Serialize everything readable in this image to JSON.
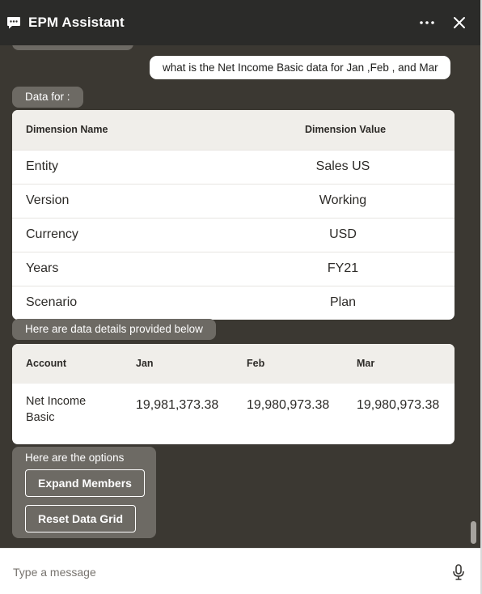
{
  "header": {
    "title": "EPM Assistant",
    "icons": {
      "chat": "chat-bubble-icon",
      "more": "more-horizontal-icon",
      "close": "close-icon"
    }
  },
  "conversation": {
    "user_message": "what is the Net Income Basic data for Jan ,Feb , and Mar",
    "data_for_label": "Data for :",
    "dimension_table": {
      "headers": [
        "Dimension Name",
        "Dimension Value"
      ],
      "rows": [
        {
          "name": "Entity",
          "value": "Sales US"
        },
        {
          "name": "Version",
          "value": "Working"
        },
        {
          "name": "Currency",
          "value": "USD"
        },
        {
          "name": "Years",
          "value": "FY21"
        },
        {
          "name": "Scenario",
          "value": "Plan"
        }
      ]
    },
    "details_label": "Here are data details provided below",
    "data_table": {
      "headers": [
        "Account",
        "Jan",
        "Feb",
        "Mar"
      ],
      "rows": [
        {
          "account": "Net Income Basic",
          "jan": "19,981,373.38",
          "feb": "19,980,973.38",
          "mar": "19,980,973.38"
        }
      ]
    },
    "options": {
      "label": "Here are the options",
      "expand_label": "Expand Members",
      "reset_label": "Reset Data Grid"
    }
  },
  "composer": {
    "placeholder": "Type a message",
    "mic_icon": "microphone-icon"
  }
}
